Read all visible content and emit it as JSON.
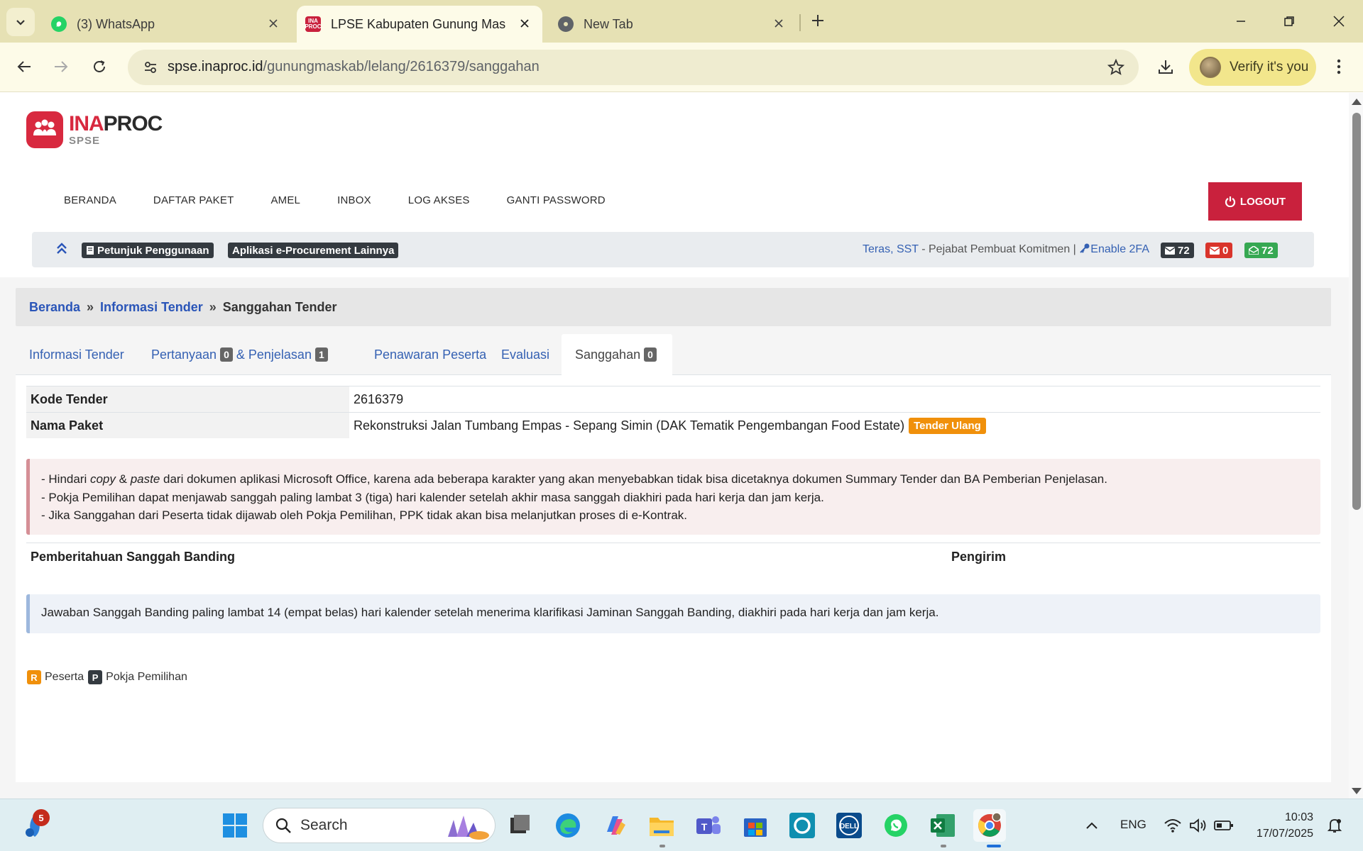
{
  "browser": {
    "tabs": [
      {
        "title": "(3) WhatsApp",
        "icon": "whatsapp-icon"
      },
      {
        "title": "LPSE Kabupaten Gunung Mas",
        "icon": "inaproc-favicon"
      },
      {
        "title": "New Tab",
        "icon": "chrome-icon"
      }
    ],
    "url_host": "spse.inaproc.id",
    "url_path": "/gunungmaskab/lelang/2616379/sanggahan",
    "verify_label": "Verify it's you"
  },
  "site": {
    "logo_main_ina": "INA",
    "logo_main_proc": "PROC",
    "logo_sub": "SPSE",
    "nav": [
      "BERANDA",
      "DAFTAR PAKET",
      "AMEL",
      "INBOX",
      "LOG AKSES",
      "GANTI PASSWORD"
    ],
    "logout": "LOGOUT",
    "petunjuk": "Petunjuk Penggunaan",
    "aplikasi": "Aplikasi e-Procurement Lainnya",
    "user_name": "Teras, SST",
    "user_role": " - Pejabat Pembuat Komitmen | ",
    "enable_2fa": "Enable 2FA",
    "count_inbox": "72",
    "count_unread": "0",
    "count_read": "72"
  },
  "breadcrumb": {
    "home": "Beranda",
    "sep": "»",
    "info": "Informasi Tender",
    "current": "Sanggahan Tender"
  },
  "tabs": {
    "informasi": "Informasi Tender",
    "pertanyaan": "Pertanyaan",
    "pertanyaan_count": "0",
    "penjelasan": "& Penjelasan",
    "penjelasan_count": "1",
    "penawaran": "Penawaran Peserta",
    "evaluasi": "Evaluasi",
    "sanggahan": "Sanggahan",
    "sanggahan_count": "0"
  },
  "detail": {
    "kode_label": "Kode Tender",
    "kode_value": "2616379",
    "nama_label": "Nama Paket",
    "nama_value": "Rekonstruksi Jalan Tumbang Empas - Sepang Simin (DAK Tematik Pengembangan Food Estate)",
    "nama_tag": "Tender Ulang"
  },
  "notice": {
    "line1_pre": "- Hindari ",
    "line1_copy": "copy",
    "line1_amp": " & ",
    "line1_paste": "paste",
    "line1_post": " dari dokumen aplikasi Microsoft Office, karena ada beberapa karakter yang akan menyebabkan tidak bisa dicetaknya dokumen Summary Tender dan BA Pemberian Penjelasan.",
    "line2": "- Pokja Pemilihan dapat menjawab sanggah paling lambat 3 (tiga) hari kalender setelah akhir masa sanggah diakhiri pada hari kerja dan jam kerja.",
    "line3": "- Jika Sanggahan dari Peserta tidak dijawab oleh Pokja Pemilihan, PPK tidak akan bisa melanjutkan proses di e-Kontrak."
  },
  "table": {
    "col1": "Pemberitahuan Sanggah Banding",
    "col2": "Pengirim"
  },
  "info_banding": "Jawaban Sanggah Banding paling lambat 14 (empat belas) hari kalender setelah menerima klarifikasi Jaminan Sanggah Banding, diakhiri pada hari kerja dan jam kerja.",
  "legend": {
    "r_letter": "R",
    "r_label": "Peserta",
    "p_letter": "P",
    "p_label": "Pokja Pemilihan"
  },
  "taskbar": {
    "notification_count": "5",
    "search_label": "Search",
    "language": "ENG",
    "time": "10:03",
    "date": "17/07/2025"
  },
  "colors": {
    "brand_red": "#d8293f",
    "link_blue": "#3561b3",
    "tag_orange": "#f0900b",
    "chrome_tabbar": "#e6e1b4"
  }
}
